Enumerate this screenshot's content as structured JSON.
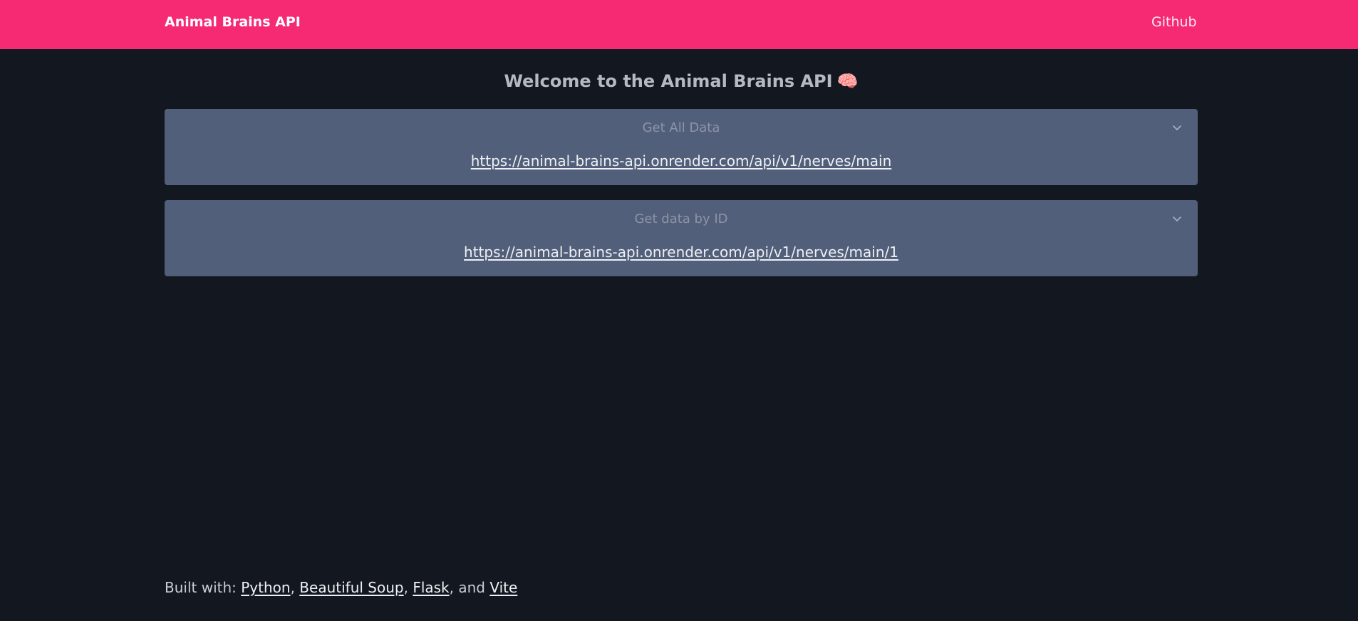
{
  "navbar": {
    "brand": "Animal Brains API",
    "github_label": "Github"
  },
  "main": {
    "title": "Welcome to the Animal Brains API",
    "title_emoji": "🧠",
    "endpoints": [
      {
        "heading": "Get All Data",
        "url": "https://animal-brains-api.onrender.com/api/v1/nerves/main",
        "icon": "chevron-down-icon"
      },
      {
        "heading": "Get data by ID",
        "url": "https://animal-brains-api.onrender.com/api/v1/nerves/main/1",
        "icon": "chevron-down-icon"
      }
    ]
  },
  "footer": {
    "prefix": "Built with: ",
    "links": [
      "Python",
      "Beautiful Soup",
      "Flask",
      "Vite"
    ],
    "sep_1": ", ",
    "sep_2": ", ",
    "sep_3": ", and "
  },
  "colors": {
    "navbar": "#f62a73",
    "background": "#131720",
    "card": "#525f7a"
  }
}
